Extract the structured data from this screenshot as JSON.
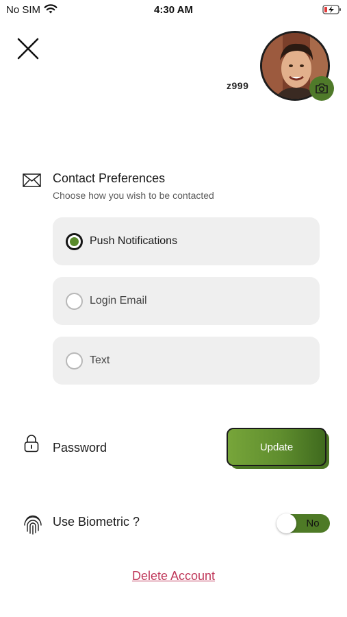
{
  "status_bar": {
    "carrier": "No SIM",
    "time": "4:30 AM",
    "wifi_icon": "wifi-icon",
    "battery_icon": "battery-charging-icon"
  },
  "header": {
    "close_icon": "close-icon",
    "username": "z999",
    "camera_icon": "camera-icon"
  },
  "contact_preferences": {
    "icon": "mail-icon",
    "title": "Contact Preferences",
    "subtitle": "Choose how you wish to be contacted",
    "options": [
      {
        "label": "Push Notifications",
        "selected": true
      },
      {
        "label": "Login Email",
        "selected": false
      },
      {
        "label": "Text",
        "selected": false
      }
    ]
  },
  "password": {
    "icon": "lock-icon",
    "label": "Password",
    "button_label": "Update"
  },
  "biometric": {
    "icon": "fingerprint-icon",
    "label": "Use Biometric ?",
    "toggle_value": "No"
  },
  "delete_account_label": "Delete Account",
  "colors": {
    "accent_green": "#5a8b2c",
    "delete_red": "#c0395b",
    "option_bg": "#efefef"
  }
}
